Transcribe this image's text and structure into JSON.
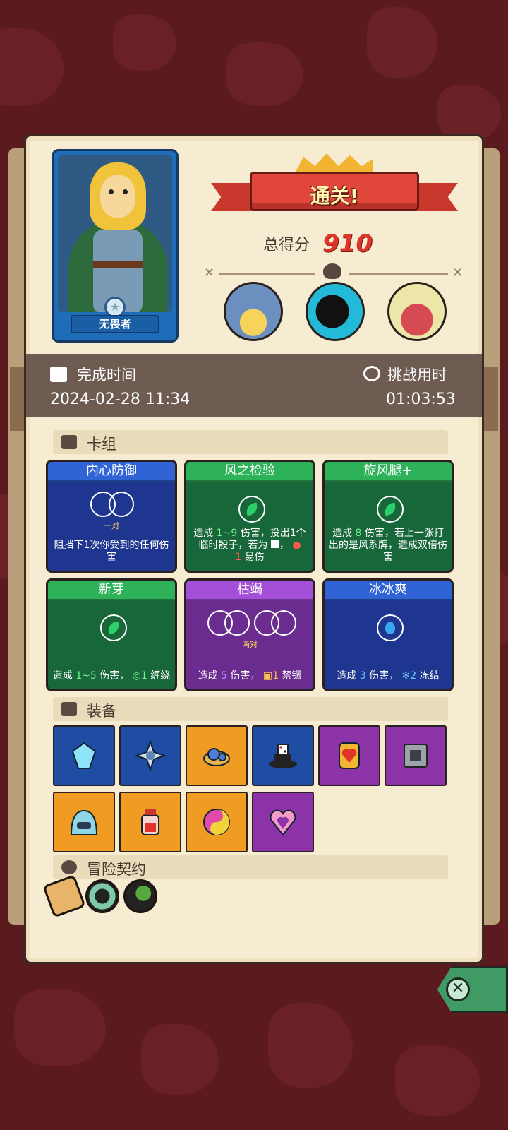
{
  "hero": {
    "name": "无畏者"
  },
  "result": {
    "banner": "通关!",
    "score_label": "总得分",
    "score_value": "910"
  },
  "time": {
    "complete_label": "完成时间",
    "complete_value": "2024-02-28 11:34",
    "elapsed_label": "挑战用时",
    "elapsed_value": "01:03:53"
  },
  "sections": {
    "deck": "卡组",
    "equipment": "装备",
    "contract": "冒险契约"
  },
  "cards": [
    {
      "title": "内心防御",
      "color": "blue",
      "art": "一对",
      "desc": "阻挡下1次你受到的任何伤害"
    },
    {
      "title": "风之检验",
      "color": "green",
      "desc_a": "造成",
      "dmg": "1~9",
      "desc_b": "伤害，投出1个临时骰子，若为",
      "desc_c": "，",
      "desc_d": "1",
      "desc_e": "易伤"
    },
    {
      "title": "旋风腿+",
      "color": "green",
      "desc_a": "造成",
      "dmg": "8",
      "desc_b": "伤害，若上一张打出的是风系牌，造成双倍伤害"
    },
    {
      "title": "新芽",
      "color": "green",
      "desc_a": "造成",
      "dmg": "1~5",
      "desc_b": "伤害，",
      "bind": "1",
      "desc_c": "缠绕"
    },
    {
      "title": "枯竭",
      "color": "purple",
      "art": "两对",
      "desc_a": "造成",
      "dmg": "5",
      "desc_b": "伤害，",
      "lock": "1",
      "desc_c": "禁锢"
    },
    {
      "title": "冰冰爽",
      "color": "blue",
      "desc_a": "造成",
      "dmg": "3",
      "desc_b": "伤害，",
      "freeze": "2",
      "desc_c": "冻结"
    }
  ],
  "equipment_icons": [
    "crystal-gem-icon",
    "ice-star-icon",
    "slime-puddle-icon",
    "magic-hat-dice-icon",
    "heart-scroll-icon",
    "cube-trap-icon",
    "ice-slime-icon",
    "potion-jar-icon",
    "yin-yang-orb-icon",
    "heart-amulet-icon"
  ],
  "colors": {
    "accent_red": "#e0342a",
    "panel": "#f6ecd2",
    "strip": "#6e5c52"
  }
}
